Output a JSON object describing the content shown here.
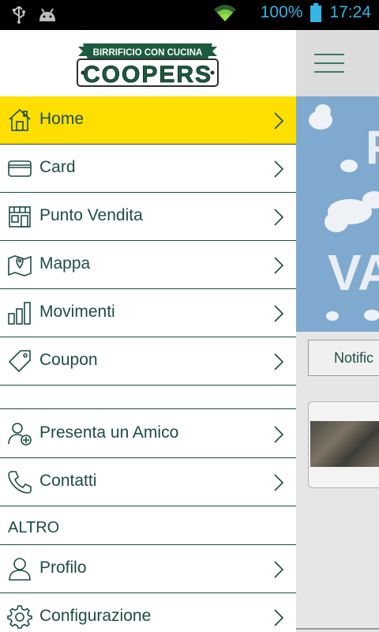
{
  "status_bar": {
    "battery": "100%",
    "time": "17:24",
    "icons": [
      "usb-icon",
      "android-debug-icon",
      "wifi-icon",
      "battery-icon"
    ]
  },
  "drawer": {
    "logo": {
      "top_text": "BIRRIFICIO CON CUCINA",
      "brand": "COOPERS"
    },
    "items": [
      {
        "label": "Home",
        "icon": "home-icon",
        "active": true
      },
      {
        "label": "Card",
        "icon": "card-icon"
      },
      {
        "label": "Punto Vendita",
        "icon": "store-icon"
      },
      {
        "label": "Mappa",
        "icon": "map-icon"
      },
      {
        "label": "Movimenti",
        "icon": "bar-chart-icon"
      },
      {
        "label": "Coupon",
        "icon": "tag-icon"
      },
      {
        "label": "Presenta un Amico",
        "icon": "add-friend-icon"
      },
      {
        "label": "Contatti",
        "icon": "phone-icon"
      },
      {
        "label": "Profilo",
        "icon": "user-icon"
      },
      {
        "label": "Configurazione",
        "icon": "gear-icon"
      }
    ],
    "section_altro": "ALTRO"
  },
  "background_app": {
    "notification_button": "Notific"
  },
  "colors": {
    "accent": "#ffdf00",
    "text": "#1c4d46",
    "status_blue": "#33b5e5"
  }
}
